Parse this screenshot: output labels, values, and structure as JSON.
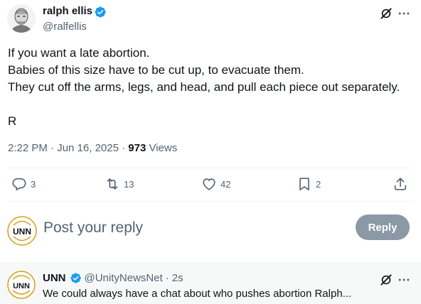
{
  "post": {
    "author": {
      "name": "ralph ellis",
      "handle": "@ralfellis",
      "verified": true
    },
    "body": [
      "If you want a late abortion.",
      "Babies of this size have to be cut up, to evacuate them.",
      "They cut off the arms, legs, and head, and pull each piece out separately."
    ],
    "signature": "R",
    "timestamp": "2:22 PM · Jun 16, 2025 · ",
    "views_count": "973",
    "views_label": " Views",
    "actions": {
      "replies": "3",
      "reposts": "13",
      "likes": "42",
      "bookmarks": "2"
    },
    "icons": [
      "grok-icon",
      "more-icon",
      "reply-icon",
      "repost-icon",
      "like-icon",
      "bookmark-icon",
      "share-icon",
      "verified-badge-icon"
    ]
  },
  "composer": {
    "placeholder": "Post your reply",
    "reply_button": "Reply",
    "avatar_text": "UNN"
  },
  "reply": {
    "name": "UNN",
    "handle": "@UnityNewsNet",
    "separator": "·",
    "time": "2s",
    "text": "We could always have a chat about who pushes abortion Ralph...",
    "avatar_text": "UNN"
  },
  "colors": {
    "verified_blue": "#1d9bf0",
    "secondary_text": "#536471",
    "primary_text": "#0f1419",
    "reply_button_disabled": "#8b98a5",
    "unn_gold": "#d4a017"
  }
}
